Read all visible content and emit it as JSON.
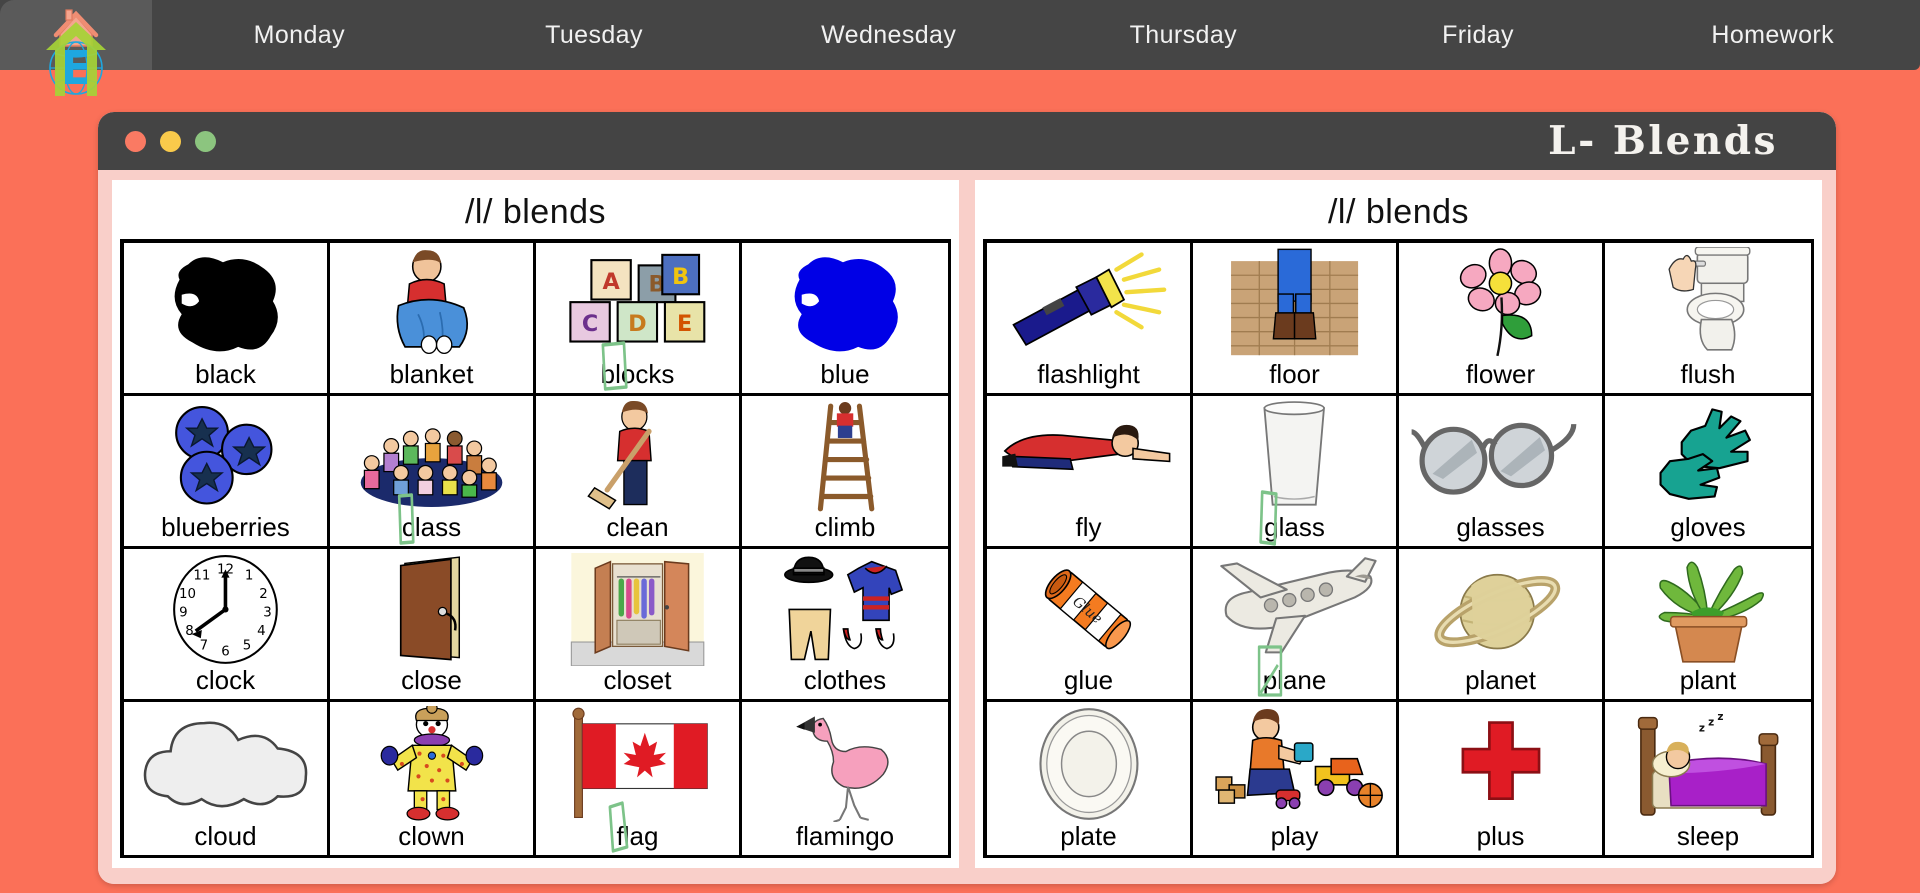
{
  "nav": {
    "logo_icon": "house-arrow-globe-e-logo",
    "items": [
      {
        "label": "Monday"
      },
      {
        "label": "Tuesday"
      },
      {
        "label": "Wednesday"
      },
      {
        "label": "Thursday"
      },
      {
        "label": "Friday"
      },
      {
        "label": "Homework"
      }
    ]
  },
  "window": {
    "title": "L- Blends",
    "traffic_lights": [
      {
        "name": "close",
        "color": "#fa7a63"
      },
      {
        "name": "minimize",
        "color": "#f9ca4b"
      },
      {
        "name": "maximize",
        "color": "#8cc57f"
      }
    ]
  },
  "colors": {
    "background": "#fb7058",
    "navbar": "#454545",
    "navbar_logo_panel": "#5a5a5a",
    "titlebar": "#444444",
    "page_frame": "#f9cfc9",
    "page": "#ffffff",
    "marker_green": "#7dc389"
  },
  "pages": [
    {
      "title": "/l/ blends",
      "cells": [
        {
          "label": "black",
          "art": "black-blob-icon",
          "marked": false
        },
        {
          "label": "blanket",
          "art": "blanket-boy-icon",
          "marked": false
        },
        {
          "label": "blocks",
          "art": "abc-blocks-icon",
          "marked": true
        },
        {
          "label": "blue",
          "art": "blue-blob-icon",
          "marked": false
        },
        {
          "label": "blueberries",
          "art": "blueberries-icon",
          "marked": false
        },
        {
          "label": "class",
          "art": "class-children-icon",
          "marked": true
        },
        {
          "label": "clean",
          "art": "clean-broom-icon",
          "marked": false
        },
        {
          "label": "climb",
          "art": "climb-ladder-icon",
          "marked": false
        },
        {
          "label": "clock",
          "art": "clock-icon",
          "marked": false
        },
        {
          "label": "close",
          "art": "close-door-icon",
          "marked": false
        },
        {
          "label": "closet",
          "art": "closet-icon",
          "marked": false
        },
        {
          "label": "clothes",
          "art": "clothes-icon",
          "marked": false
        },
        {
          "label": "cloud",
          "art": "cloud-icon",
          "marked": false
        },
        {
          "label": "clown",
          "art": "clown-icon",
          "marked": false
        },
        {
          "label": "flag",
          "art": "canada-flag-icon",
          "marked": true
        },
        {
          "label": "flamingo",
          "art": "flamingo-icon",
          "marked": false
        }
      ]
    },
    {
      "title": "/l/ blends",
      "cells": [
        {
          "label": "flashlight",
          "art": "flashlight-icon",
          "marked": false
        },
        {
          "label": "floor",
          "art": "floor-boots-icon",
          "marked": false
        },
        {
          "label": "flower",
          "art": "flower-icon",
          "marked": false
        },
        {
          "label": "flush",
          "art": "toilet-flush-icon",
          "marked": false
        },
        {
          "label": "fly",
          "art": "fly-person-icon",
          "marked": false
        },
        {
          "label": "glass",
          "art": "glass-icon",
          "marked": true
        },
        {
          "label": "glasses",
          "art": "glasses-icon",
          "marked": false
        },
        {
          "label": "gloves",
          "art": "gloves-icon",
          "marked": false
        },
        {
          "label": "glue",
          "art": "glue-stick-icon",
          "marked": false
        },
        {
          "label": "plane",
          "art": "plane-icon",
          "marked": true
        },
        {
          "label": "planet",
          "art": "planet-icon",
          "marked": false
        },
        {
          "label": "plant",
          "art": "plant-pot-icon",
          "marked": false
        },
        {
          "label": "plate",
          "art": "plate-icon",
          "marked": false
        },
        {
          "label": "play",
          "art": "play-toys-icon",
          "marked": false
        },
        {
          "label": "plus",
          "art": "plus-sign-icon",
          "marked": false
        },
        {
          "label": "sleep",
          "art": "sleep-bed-icon",
          "marked": false
        }
      ]
    }
  ],
  "clock_time": "7:58"
}
